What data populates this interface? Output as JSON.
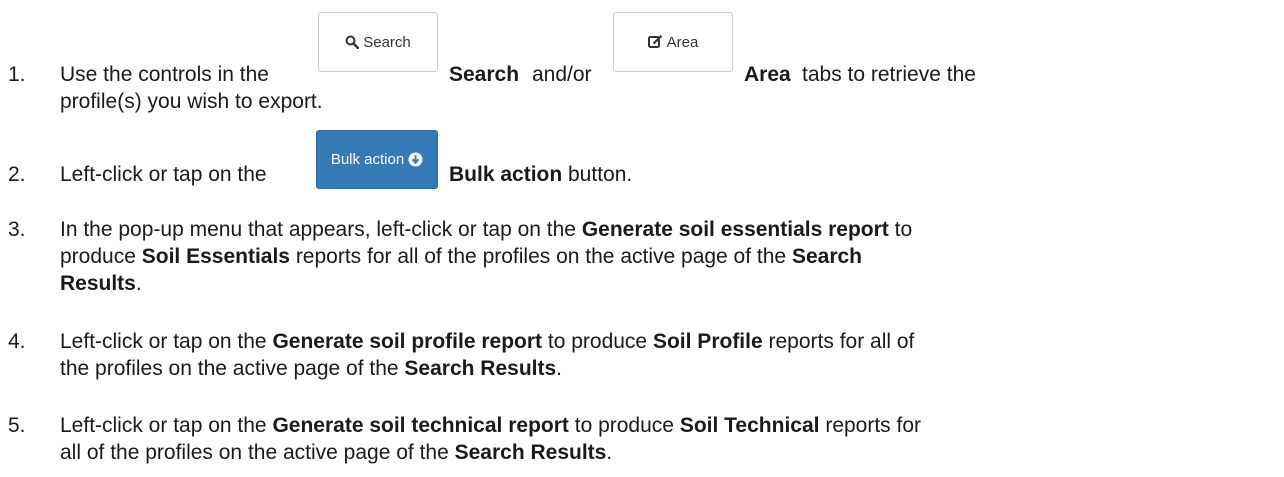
{
  "steps": [
    {
      "number": "1.",
      "pre": "Use the controls in the",
      "search_button": "Search",
      "search_label": "Search",
      "and_or": "and/or",
      "area_button": "Area",
      "area_label": "Area",
      "post": "tabs to retrieve the",
      "line2": "profile(s) you wish to export."
    },
    {
      "number": "2.",
      "pre": "Left-click or tap on the",
      "bulk_button": "Bulk action",
      "bulk_label": "Bulk action",
      "post": "button."
    },
    {
      "number": "3.",
      "t1": "In the pop-up menu that appears, left-click or tap on the",
      "b1": "Generate soil essentials report",
      "t2": "to",
      "t3": "produce",
      "b2": "Soil Essentials",
      "t4": "reports for all of the profiles on the active page of the",
      "b3": "Search",
      "b4": "Results",
      "t5": "."
    },
    {
      "number": "4.",
      "t1": "Left-click or tap on the",
      "b1": "Generate soil profile report",
      "t2": "to produce",
      "b2": "Soil Profile",
      "t3": "reports for all of",
      "t4": "the profiles on the active page of the",
      "b3": "Search Results",
      "t5": "."
    },
    {
      "number": "5.",
      "t1": "Left-click or tap on the",
      "b1": "Generate soil technical report",
      "t2": "to produce",
      "b2": "Soil Technical",
      "t3": "reports for",
      "t4": "all of the profiles on the active page of the",
      "b3": "Search Results",
      "t5": "."
    }
  ],
  "icons": {
    "search": "magnifier-icon",
    "area": "edit-square-icon",
    "bulk": "circle-arrow-down-icon"
  },
  "colors": {
    "primary_button": "#337ab7",
    "default_button_border": "#cccccc"
  }
}
